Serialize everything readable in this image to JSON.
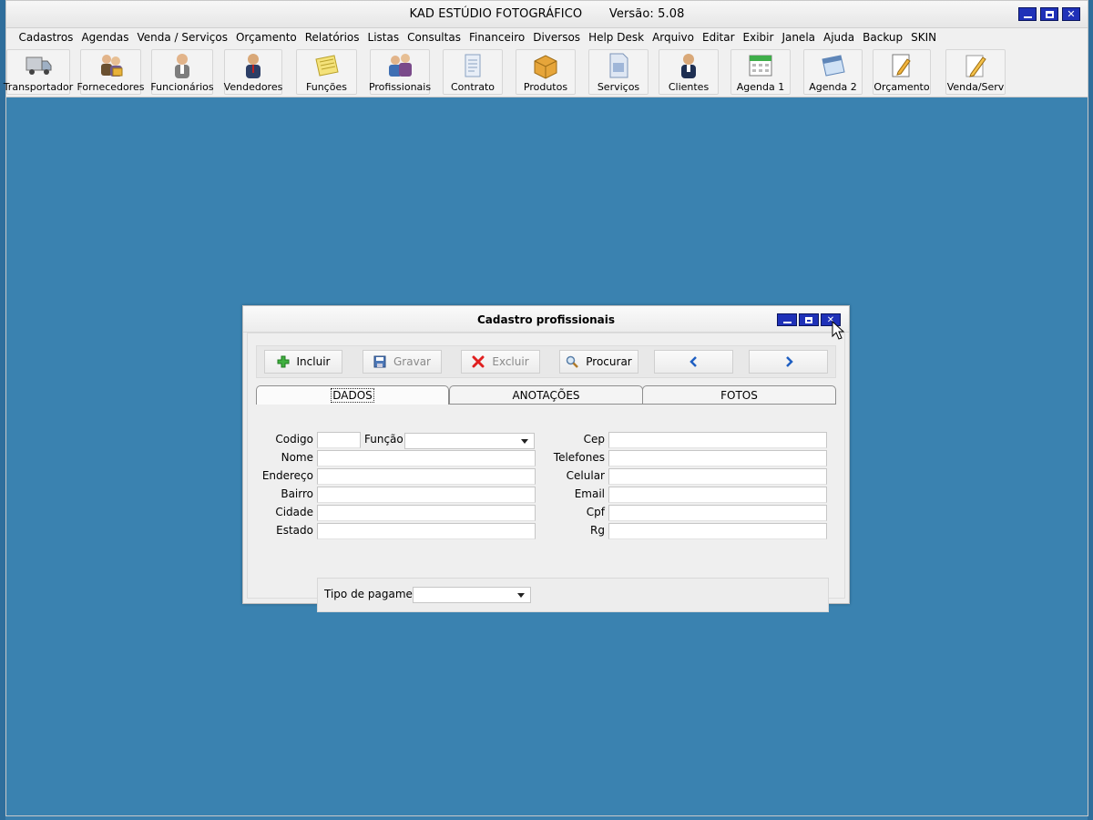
{
  "app": {
    "title": "KAD ESTÚDIO FOTOGRÁFICO       Versão: 5.08"
  },
  "menu": [
    {
      "label": "Cadastros"
    },
    {
      "label": "Agendas"
    },
    {
      "label": "Venda / Serviços"
    },
    {
      "label": "Orçamento"
    },
    {
      "label": "Relatórios"
    },
    {
      "label": "Listas"
    },
    {
      "label": "Consultas"
    },
    {
      "label": "Financeiro"
    },
    {
      "label": "Diversos"
    },
    {
      "label": "Help Desk"
    },
    {
      "label": "Arquivo"
    },
    {
      "label": "Editar"
    },
    {
      "label": "Exibir"
    },
    {
      "label": "Janela"
    },
    {
      "label": "Ajuda"
    },
    {
      "label": "Backup"
    },
    {
      "label": "SKIN"
    }
  ],
  "toolbar": [
    {
      "label": "Transportador",
      "icon": "truck-icon"
    },
    {
      "label": "Fornecedores",
      "icon": "suppliers-icon"
    },
    {
      "label": "Funcionários",
      "icon": "employee-icon"
    },
    {
      "label": "Vendedores",
      "icon": "seller-icon"
    },
    {
      "label": "Funções",
      "icon": "notes-icon"
    },
    {
      "label": "Profissionais",
      "icon": "professionals-icon"
    },
    {
      "label": "Contrato",
      "icon": "contract-icon"
    },
    {
      "label": "Produtos",
      "icon": "box-icon"
    },
    {
      "label": "Serviços",
      "icon": "document-icon"
    },
    {
      "label": "Clientes",
      "icon": "client-icon"
    },
    {
      "label": "Agenda 1",
      "icon": "calendar-icon"
    },
    {
      "label": "Agenda 2",
      "icon": "calendar-icon"
    },
    {
      "label": "Orçamento",
      "icon": "quote-icon"
    },
    {
      "label": "Venda/Serv",
      "icon": "pencil-icon"
    }
  ],
  "dialog": {
    "title": "Cadastro profissionais",
    "actions": {
      "incluir": "Incluir",
      "gravar": "Gravar",
      "excluir": "Excluir",
      "procurar": "Procurar"
    },
    "tabs": [
      "DADOS",
      "ANOTAÇÕES",
      "FOTOS"
    ],
    "fields": {
      "codigo": "Codigo",
      "funcao": "Função",
      "nome": "Nome",
      "endereco": "Endereço",
      "bairro": "Bairro",
      "cidade": "Cidade",
      "estado": "Estado",
      "cep": "Cep",
      "telefones": "Telefones",
      "celular": "Celular",
      "email": "Email",
      "cpf": "Cpf",
      "rg": "Rg",
      "tipo_pagamento": "Tipo de pagamento"
    },
    "values": {
      "codigo": "",
      "funcao": "",
      "nome": "",
      "endereco": "",
      "bairro": "",
      "cidade": "",
      "estado": "",
      "cep": "",
      "telefones": "",
      "celular": "",
      "email": "",
      "cpf": "",
      "rg": "",
      "tipo_pagamento": ""
    }
  },
  "colors": {
    "desktop": "#3a82b0",
    "window_button": "#1f31b8",
    "toolbar_bg": "#f0f0f0"
  }
}
